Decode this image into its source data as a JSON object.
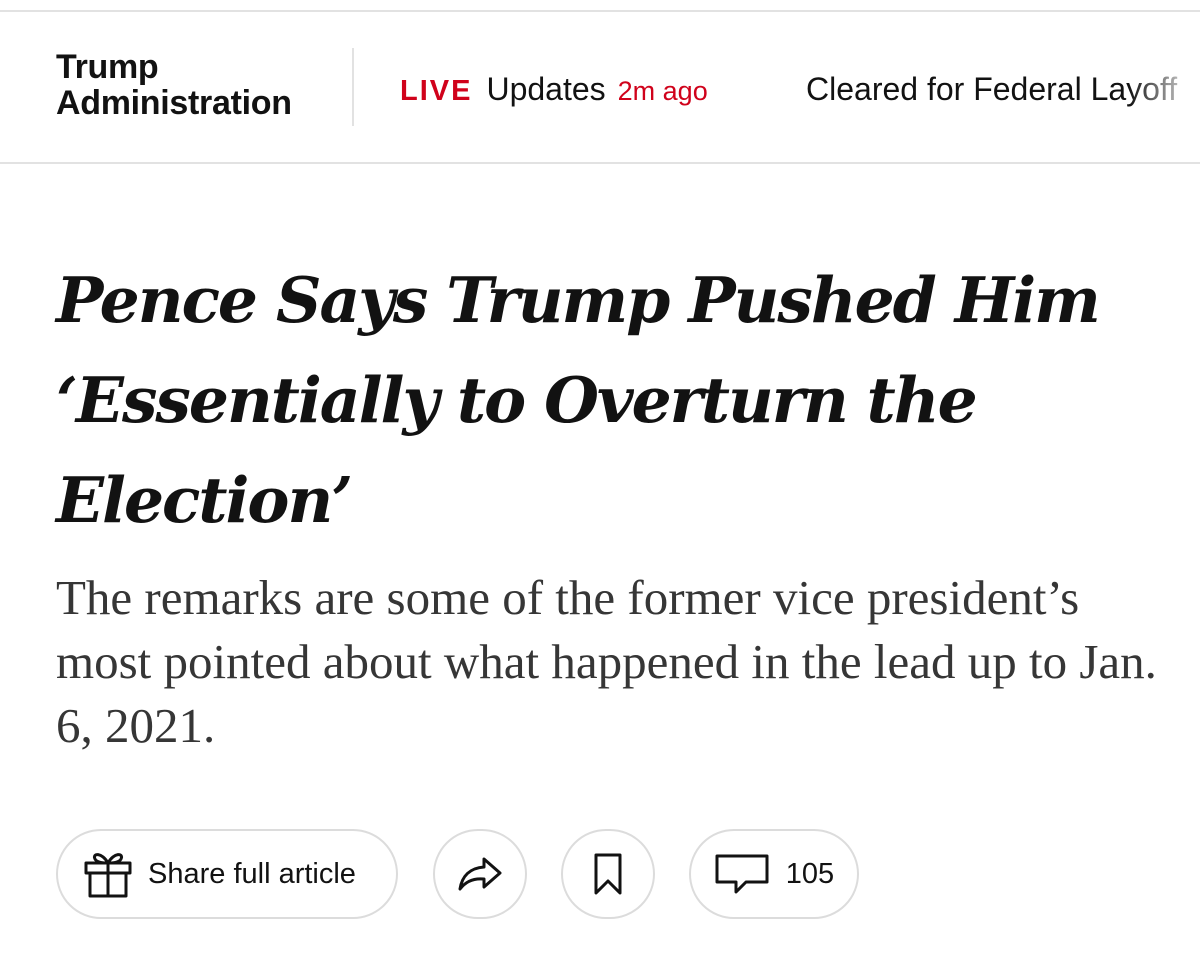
{
  "nav": {
    "section_line1": "Trump",
    "section_line2": "Administration",
    "live_badge": "LIVE",
    "live_text": "Updates",
    "live_time": "2m ago",
    "next_item": "Cleared for Federal Layoff"
  },
  "article": {
    "headline": "Pence Says Trump Pushed Him ‘Essentially to Overturn the Election’",
    "summary": "The remarks are some of the former vice president’s most pointed about what happened in the lead up to Jan. 6, 2021."
  },
  "actions": {
    "share_label": "Share full article",
    "share_icon": "gift-icon",
    "forward_icon": "share-arrow-icon",
    "save_icon": "bookmark-icon",
    "comment_icon": "comment-bubble-icon",
    "comment_count": "105"
  },
  "colors": {
    "live_red": "#d0021b",
    "text": "#121212",
    "summary_text": "#363636",
    "border": "#dcdcdc"
  }
}
